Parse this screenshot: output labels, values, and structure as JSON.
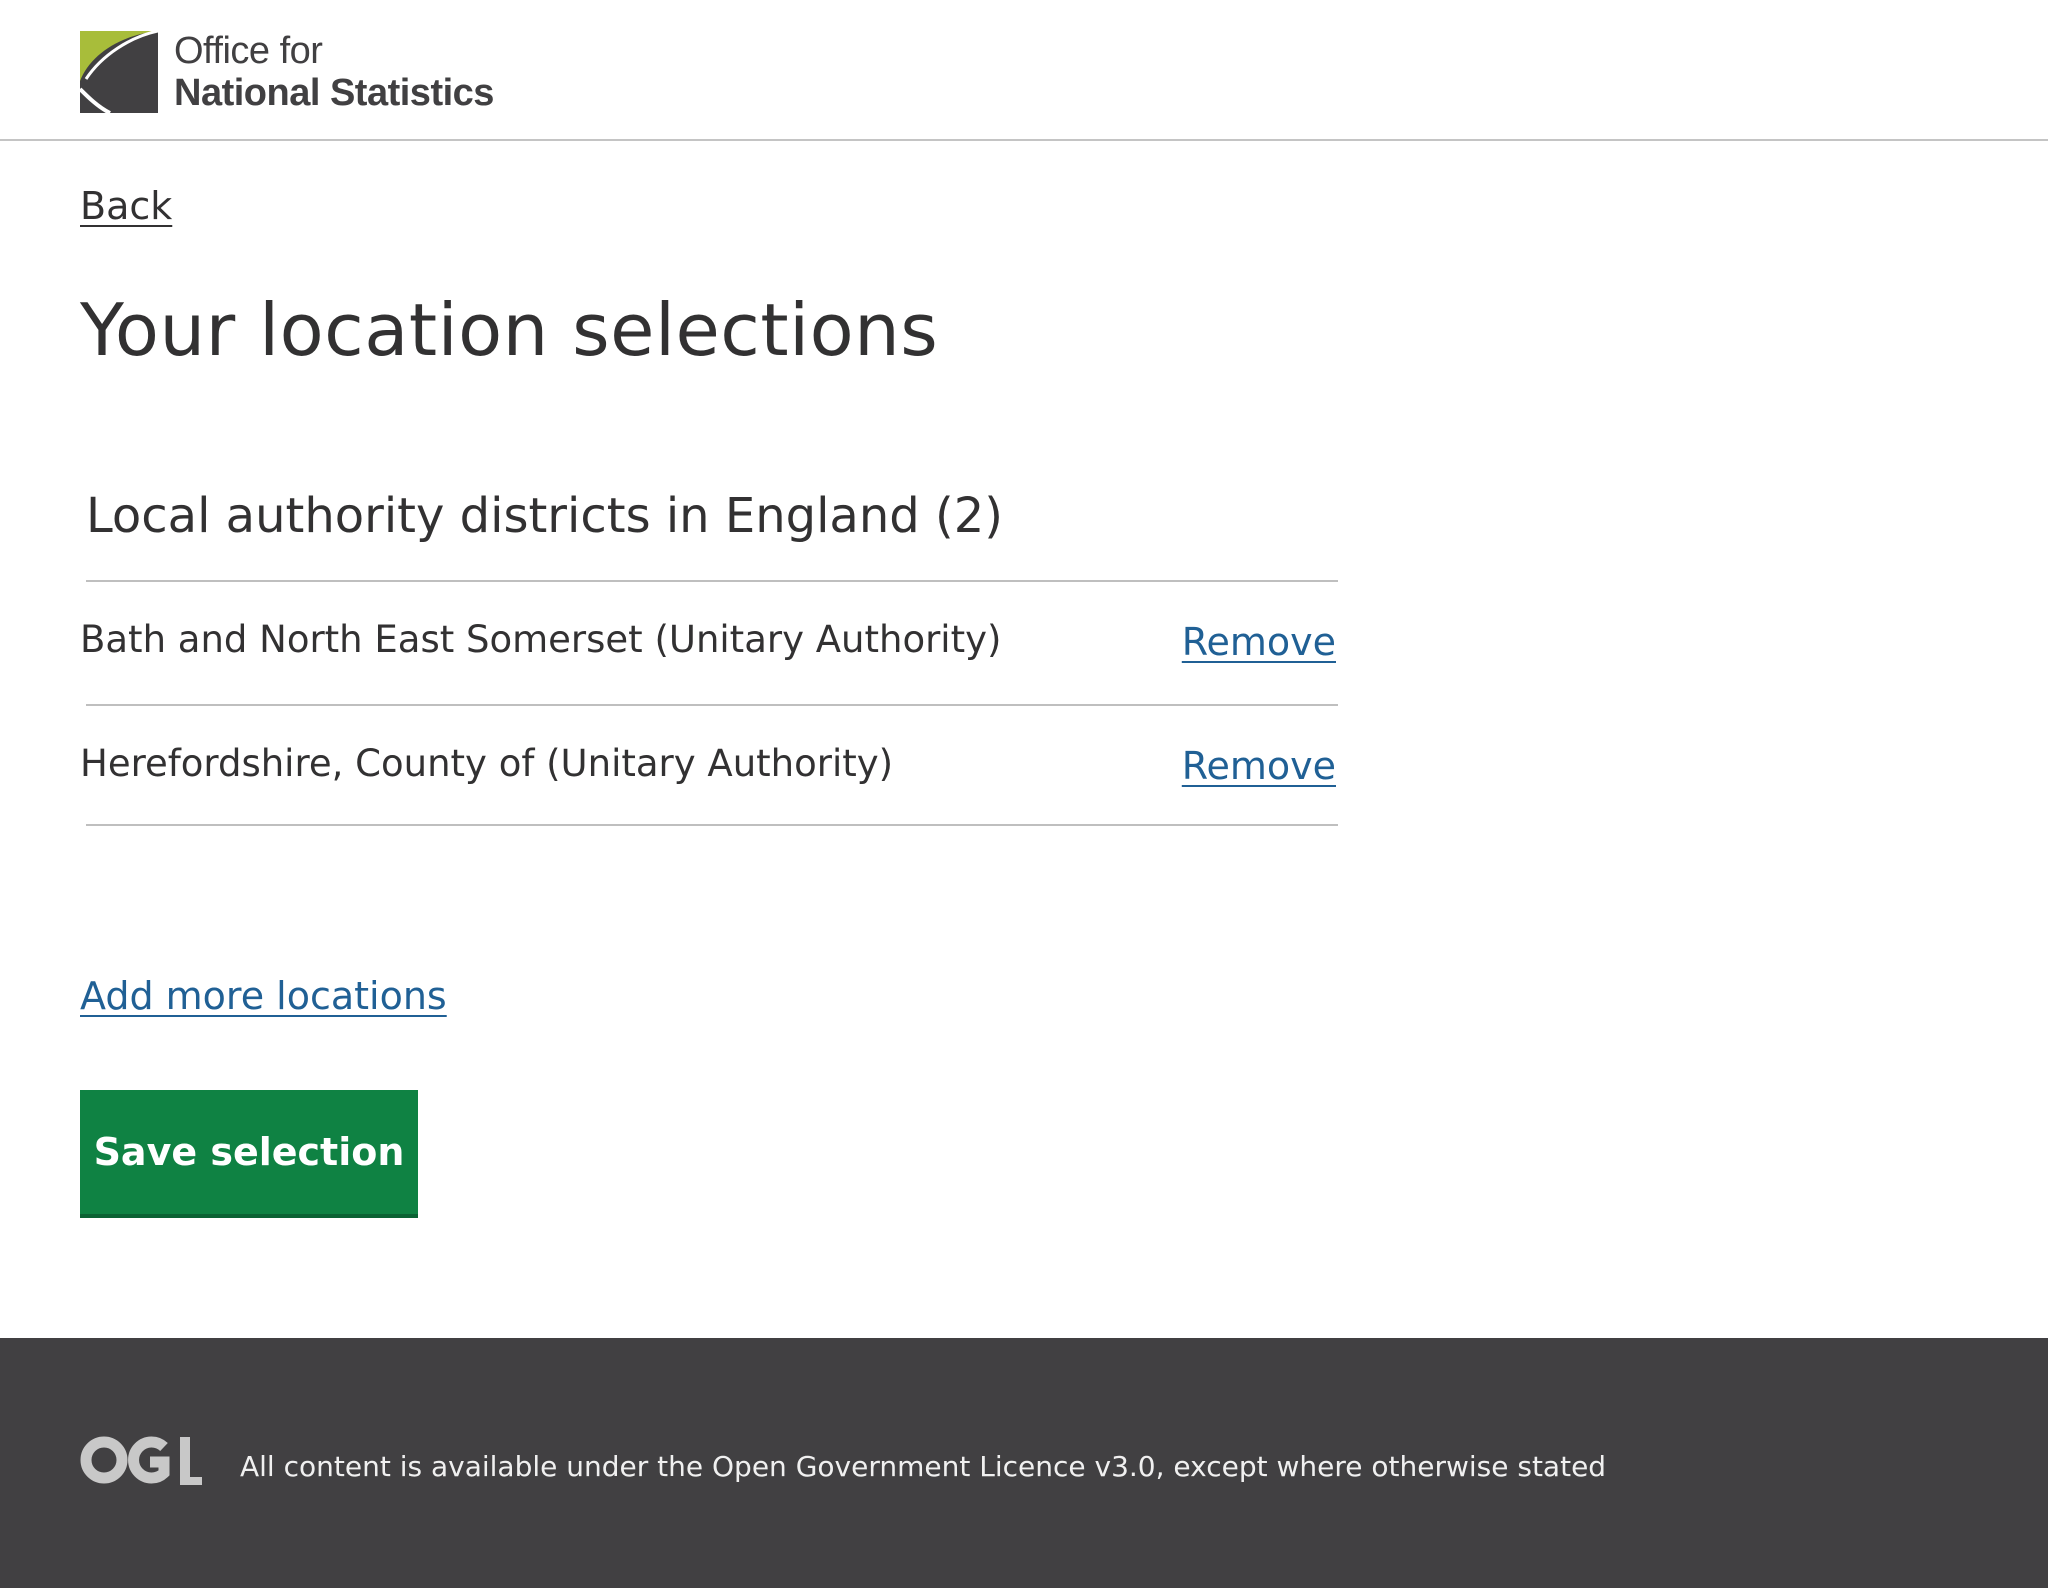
{
  "header": {
    "logo": {
      "icon": "ons-logo-icon",
      "line1": "Office for",
      "line2": "National Statistics",
      "colors": {
        "green": "#a8bd3a",
        "dark": "#414042"
      }
    }
  },
  "nav": {
    "back_label": "Back"
  },
  "main": {
    "title": "Your location selections",
    "group": {
      "title": "Local authority districts in England (2)",
      "items": [
        {
          "name": "Bath and North East Somerset (Unitary Authority)",
          "action": "Remove"
        },
        {
          "name": "Herefordshire, County of (Unitary Authority)",
          "action": "Remove"
        }
      ]
    },
    "add_more_label": "Add more locations",
    "save_label": "Save selection"
  },
  "footer": {
    "logo_icon": "ogl-logo-icon",
    "licence_text": "All content is available under the Open Government Licence v3.0, except where otherwise stated"
  },
  "colors": {
    "link": "#206095",
    "button": "#0f8243",
    "footer_bg": "#414042",
    "text": "#323132"
  }
}
